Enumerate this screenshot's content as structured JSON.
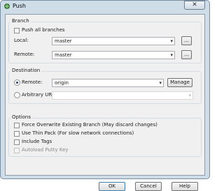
{
  "window": {
    "title": "Push",
    "close_glyph": "✕",
    "app_icon": "tortoise-git-icon"
  },
  "branch": {
    "group_title": "Branch",
    "push_all_label": "Push all branches",
    "local_label": "Local:",
    "local_value": "master",
    "remote_label": "Remote:",
    "remote_value": "master",
    "browse_label": "..."
  },
  "destination": {
    "group_title": "Destination",
    "remote_label": "Remote:",
    "remote_value": "origin",
    "manage_label": "Manage",
    "arbitrary_url_label": "Arbitrary URL:",
    "arbitrary_url_value": ""
  },
  "options": {
    "group_title": "Options",
    "force_label": "Force Overwrite Existing Branch (May discard changes)",
    "thin_pack_label": "Use Thin Pack (For slow network connections)",
    "include_tags_label": "Include Tags",
    "autoload_label": "Autoload Putty Key"
  },
  "buttons": {
    "ok": "OK",
    "cancel": "Cancel",
    "help": "Help"
  },
  "icons": {
    "dropdown": "▾"
  }
}
